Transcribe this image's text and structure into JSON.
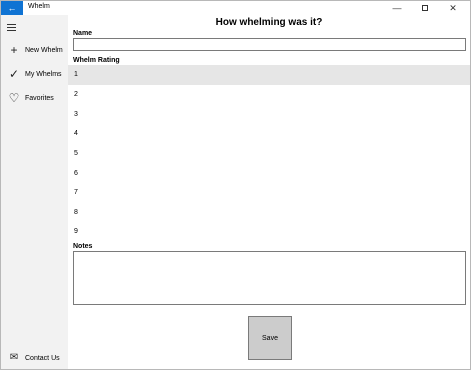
{
  "window": {
    "title": "Whelm",
    "back_icon": "arrow-left-icon",
    "minimize_glyph": "—",
    "close_glyph": "✕"
  },
  "sidebar": {
    "menu_icon": "hamburger-menu-icon",
    "items": [
      {
        "label": "New Whelm",
        "icon": "plus-icon",
        "glyph": "+"
      },
      {
        "label": "My Whelms",
        "icon": "checkmark-icon",
        "glyph": "✓"
      },
      {
        "label": "Favorites",
        "icon": "heart-icon",
        "glyph": "♡"
      }
    ],
    "footer_item": {
      "label": "Contact Us",
      "icon": "mail-icon",
      "glyph": "✉"
    }
  },
  "main": {
    "title": "How whelming was it?",
    "name_label": "Name",
    "name_value": "",
    "rating_label": "Whelm Rating",
    "ratings": [
      "1",
      "2",
      "3",
      "4",
      "5",
      "6",
      "7",
      "8",
      "9"
    ],
    "selected_rating": "1",
    "notes_label": "Notes",
    "notes_value": "",
    "save_label": "Save"
  }
}
